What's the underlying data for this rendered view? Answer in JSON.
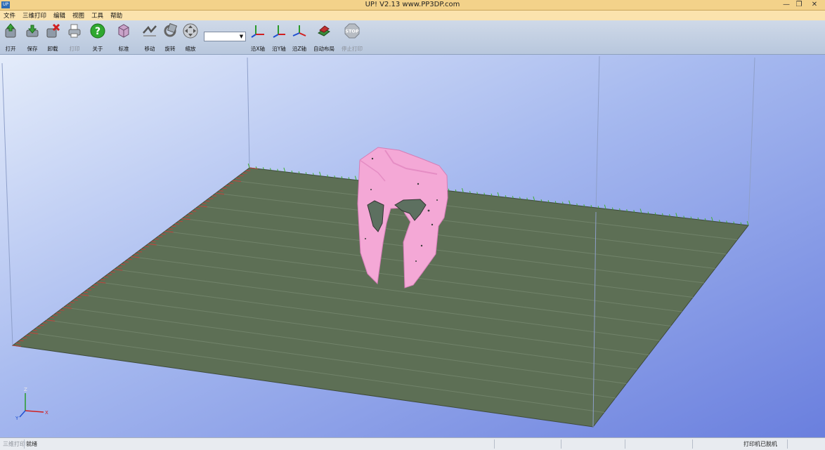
{
  "window": {
    "title": "UP!  V2.13 www.PP3DP.com",
    "app_icon_text": "UP",
    "minimize_label": "—",
    "restore_label": "❐",
    "close_label": "✕"
  },
  "menu": [
    "文件",
    "三维打印",
    "编辑",
    "视图",
    "工具",
    "帮助"
  ],
  "toolbar": {
    "open": "打开",
    "save": "保存",
    "unload": "卸载",
    "print": "打印",
    "about": "关于",
    "standard": "标准",
    "move": "移动",
    "rotate": "旋转",
    "scale": "缩放",
    "select_value": "",
    "along_x": "沿X轴",
    "along_y": "沿Y轴",
    "along_z": "沿Z轴",
    "auto_layout": "自动布局",
    "stop_print": "停止打印",
    "stop_badge": "STOP"
  },
  "viewport": {
    "axis_z": "Z",
    "axis_x": "X",
    "axis_y": "Y"
  },
  "status": {
    "pane1": "三维打印",
    "pane2": "就绪",
    "printer_status": "打印机已脱机"
  },
  "colors": {
    "platform": "#5d6f55",
    "x_ruler": "#c2403a",
    "y_ruler": "#3fae2e",
    "model": "#f3a6d6"
  }
}
